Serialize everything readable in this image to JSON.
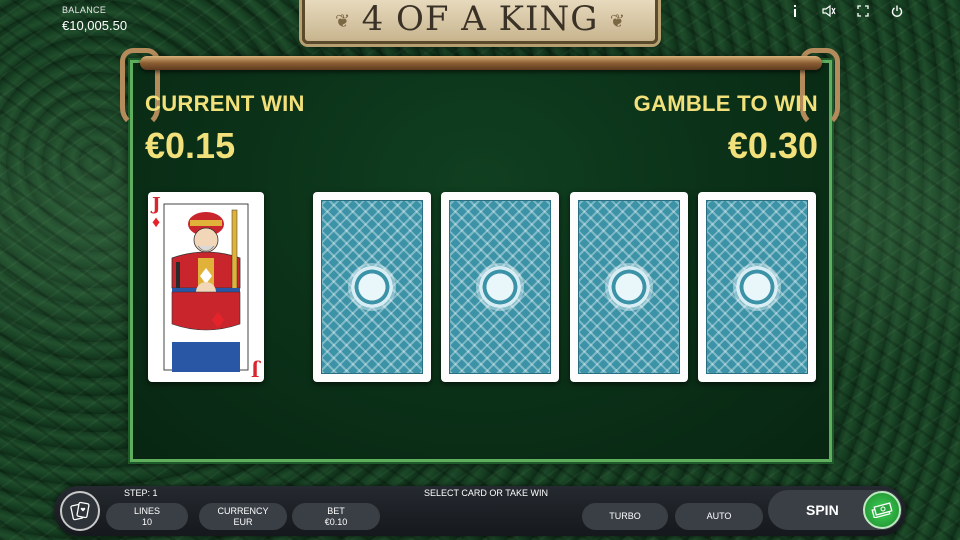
{
  "header": {
    "balance_label": "BALANCE",
    "balance_value": "€10,005.50",
    "title": "4 OF A KING",
    "icons": [
      "info-icon",
      "sound-icon",
      "fullscreen-icon",
      "power-icon"
    ]
  },
  "gamble": {
    "current_win_label": "CURRENT WIN",
    "current_win_value": "€0.15",
    "gamble_to_win_label": "GAMBLE TO WIN",
    "gamble_to_win_value": "€0.30",
    "dealer_card": {
      "rank": "J",
      "suit": "♦"
    },
    "hidden_cards": 4
  },
  "footer": {
    "step": "STEP: 1",
    "message": "SELECT CARD OR TAKE WIN",
    "lines_label": "LINES",
    "lines_value": "10",
    "currency_label": "CURRENCY",
    "currency_value": "EUR",
    "bet_label": "BET",
    "bet_value": "€0.10",
    "turbo": "TURBO",
    "auto": "AUTO",
    "spin": "SPIN"
  },
  "colors": {
    "gold_text": "#f2e17a",
    "card_back": "#3c93a8",
    "board_border": "#5fae5e"
  }
}
